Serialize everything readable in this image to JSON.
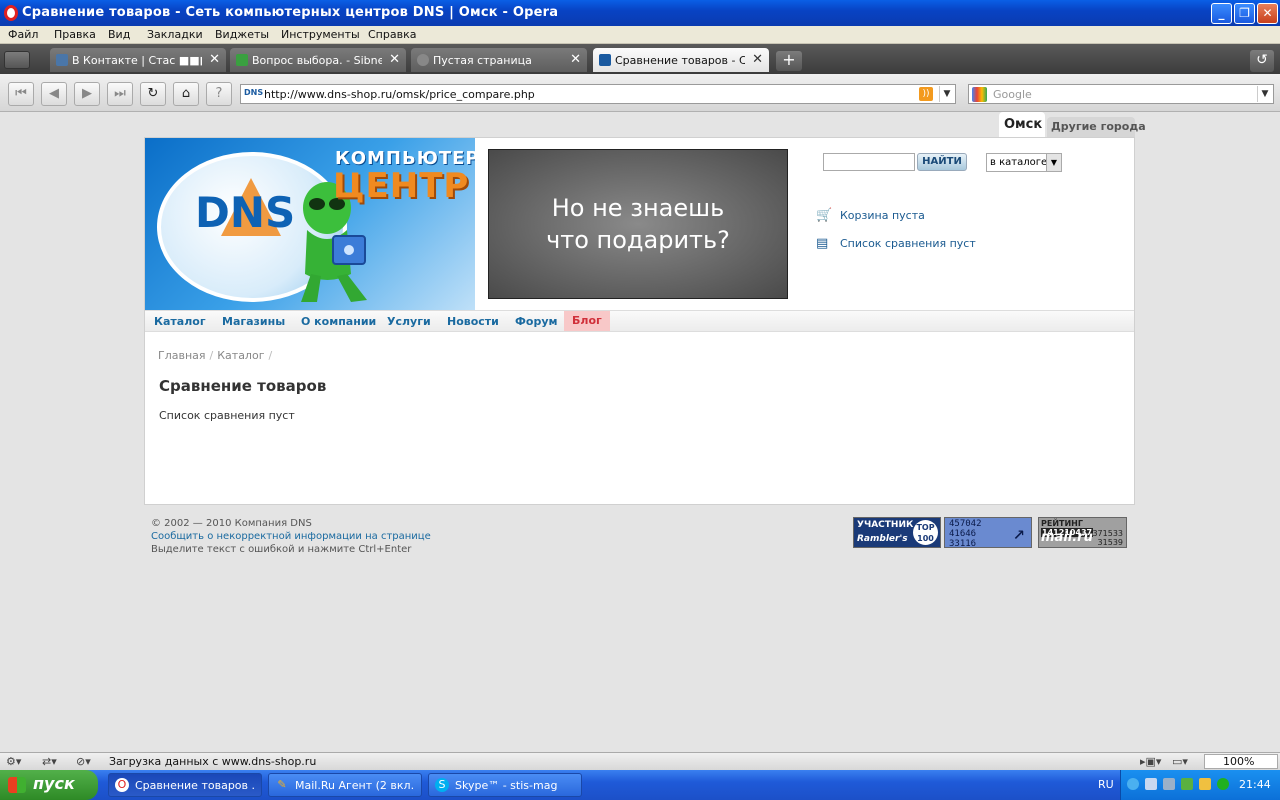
{
  "window": {
    "title": "Сравнение товаров - Сеть компьютерных центров DNS | Омск - Opera"
  },
  "menu": [
    "Файл",
    "Правка",
    "Вид",
    "Закладки",
    "Виджеты",
    "Инструменты",
    "Справка"
  ],
  "tabs": [
    {
      "label": "В Контакте | Стас ■■■",
      "active": false
    },
    {
      "label": "Вопрос выбора. - Sibnet...",
      "active": false
    },
    {
      "label": "Пустая страница",
      "active": false
    },
    {
      "label": "Сравнение товаров - С...",
      "active": true
    }
  ],
  "address": {
    "url": "http://www.dns-shop.ru/omsk/price_compare.php",
    "favicon": "DNS"
  },
  "search": {
    "placeholder": "Google"
  },
  "site": {
    "cities": {
      "current": "Омск",
      "other": "Другие города"
    },
    "logo": {
      "brand": "DNS",
      "line1": "КОМПЬЮТЕР",
      "line2": "ЦЕНТР"
    },
    "banner": {
      "line1": "Но не знаешь",
      "line2": "что подарить?"
    },
    "header_search": {
      "button": "НАЙТИ",
      "scope": "в каталоге"
    },
    "cart": "Корзина пуста",
    "compare": "Список сравнения пуст",
    "nav": [
      "Каталог",
      "Магазины",
      "О компании",
      "Услуги",
      "Новости",
      "Форум",
      "Блог"
    ],
    "breadcrumb": [
      "Главная",
      "Каталог"
    ],
    "page_title": "Сравнение товаров",
    "empty_message": "Список сравнения пуст"
  },
  "footer": {
    "copyright": "© 2002 — 2010 Компания DNS",
    "report_link": "Сообщить о некорректной информации на странице",
    "hint": "Выделите текст с ошибкой и нажмите Ctrl+Enter",
    "rambler": {
      "line1": "УЧАСТНИК",
      "line2": "Rambler's",
      "badge": "TOP 100"
    },
    "liveinternet": [
      "457042",
      "41646",
      "33116"
    ],
    "mailru": {
      "label": "РЕЙТИНГ",
      "id": "141210437",
      "brand": "mail.ru",
      "n1": "371533",
      "n2": "31539"
    }
  },
  "statusbar": {
    "message": "Загрузка данных с www.dns-shop.ru",
    "zoom": "100%"
  },
  "taskbar": {
    "start": "пуск",
    "tasks": [
      {
        "label": "Сравнение товаров ...",
        "active": true
      },
      {
        "label": "Mail.Ru Агент (2 вкл...",
        "active": false
      },
      {
        "label": "Skype™ - stis-mag",
        "active": false
      }
    ],
    "lang": "RU",
    "clock": "21:44"
  },
  "colors": {
    "accent_link": "#1a6aa0",
    "brand_orange": "#f08a20",
    "blog_highlight": "#f8c8c8"
  }
}
